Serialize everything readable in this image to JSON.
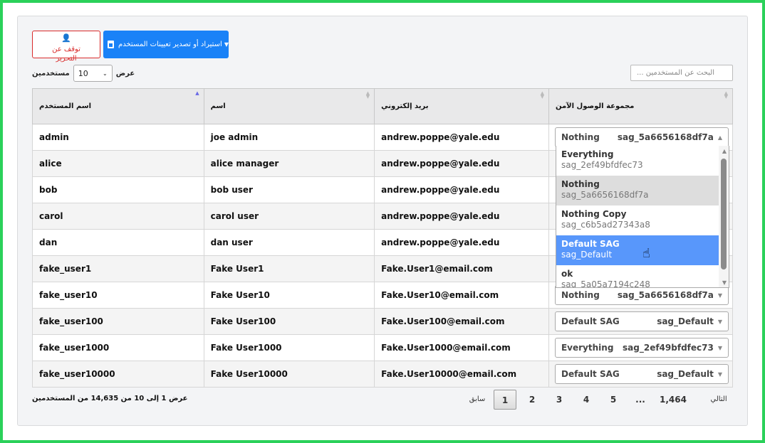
{
  "toolbar": {
    "export_label": "استيراد أو تصدير تعيينات المستخدم",
    "stop_label_line1": "توقف عن",
    "stop_label_line2": "التحرير"
  },
  "length_menu": {
    "show_label": "عرض",
    "value": "10",
    "users_label": "مستخدمين"
  },
  "search": {
    "placeholder": "... البحث عن المستخدمين"
  },
  "table": {
    "headers": {
      "username": "اسم المستخدم",
      "name": "اسم",
      "email": "بريد إلكتروني",
      "sag": "مجموعة الوصول الآمن"
    },
    "rows": [
      {
        "username": "admin",
        "name": "joe admin",
        "email": "andrew.poppe@yale.edu",
        "sag_name": "Nothing",
        "sag_code": "sag_5a6656168df7a"
      },
      {
        "username": "alice",
        "name": "alice manager",
        "email": "andrew.poppe@yale.edu",
        "sag_name": "",
        "sag_code": ""
      },
      {
        "username": "bob",
        "name": "bob user",
        "email": "andrew.poppe@yale.edu",
        "sag_name": "",
        "sag_code": ""
      },
      {
        "username": "carol",
        "name": "carol user",
        "email": "andrew.poppe@yale.edu",
        "sag_name": "",
        "sag_code": ""
      },
      {
        "username": "dan",
        "name": "dan user",
        "email": "andrew.poppe@yale.edu",
        "sag_name": "",
        "sag_code": ""
      },
      {
        "username": "fake_user1",
        "name": "Fake User1",
        "email": "Fake.User1@email.com",
        "sag_name": "",
        "sag_code": ""
      },
      {
        "username": "fake_user10",
        "name": "Fake User10",
        "email": "Fake.User10@email.com",
        "sag_name": "Nothing",
        "sag_code": "sag_5a6656168df7a"
      },
      {
        "username": "fake_user100",
        "name": "Fake User100",
        "email": "Fake.User100@email.com",
        "sag_name": "Default SAG",
        "sag_code": "sag_Default"
      },
      {
        "username": "fake_user1000",
        "name": "Fake User1000",
        "email": "Fake.User1000@email.com",
        "sag_name": "Everything",
        "sag_code": "sag_2ef49bfdfec73"
      },
      {
        "username": "fake_user10000",
        "name": "Fake User10000",
        "email": "Fake.User10000@email.com",
        "sag_name": "Default SAG",
        "sag_code": "sag_Default"
      }
    ]
  },
  "dropdown": {
    "options": [
      {
        "title": "Everything",
        "code": "sag_2ef49bfdfec73",
        "state": "normal"
      },
      {
        "title": "Nothing",
        "code": "sag_5a6656168df7a",
        "state": "hover"
      },
      {
        "title": "Nothing Copy",
        "code": "sag_c6b5ad27343a8",
        "state": "normal"
      },
      {
        "title": "Default SAG",
        "code": "sag_Default",
        "state": "selected"
      },
      {
        "title": "ok",
        "code": "sag_5a05a7194c248",
        "state": "normal"
      }
    ]
  },
  "footer": {
    "info": "عرض 1 إلى 10 من 14,635 من المستخدمين",
    "prev": "سابق",
    "next": "التالي",
    "pages": [
      "1",
      "2",
      "3",
      "4",
      "5",
      "...",
      "1,464"
    ],
    "current_page": "1"
  }
}
